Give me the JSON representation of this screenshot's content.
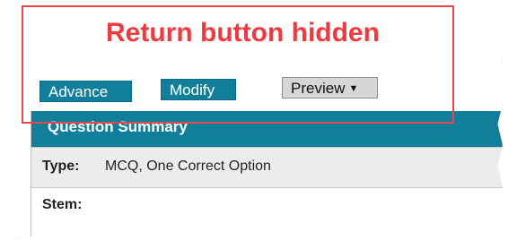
{
  "annotation": {
    "text": "Return button hidden",
    "color": "#ee3b41"
  },
  "toolbar": {
    "advance_label": "Advance",
    "modify_label": "Modify",
    "preview_label": "Preview",
    "preview_caret": "▼"
  },
  "summary": {
    "title": "Question Summary",
    "type_label": "Type:",
    "type_value": "MCQ, One Correct Option",
    "stem_label": "Stem:"
  },
  "colors": {
    "accent": "#117f9a",
    "callout": "#e8484c",
    "preview_bg": "#d6d6d6"
  }
}
